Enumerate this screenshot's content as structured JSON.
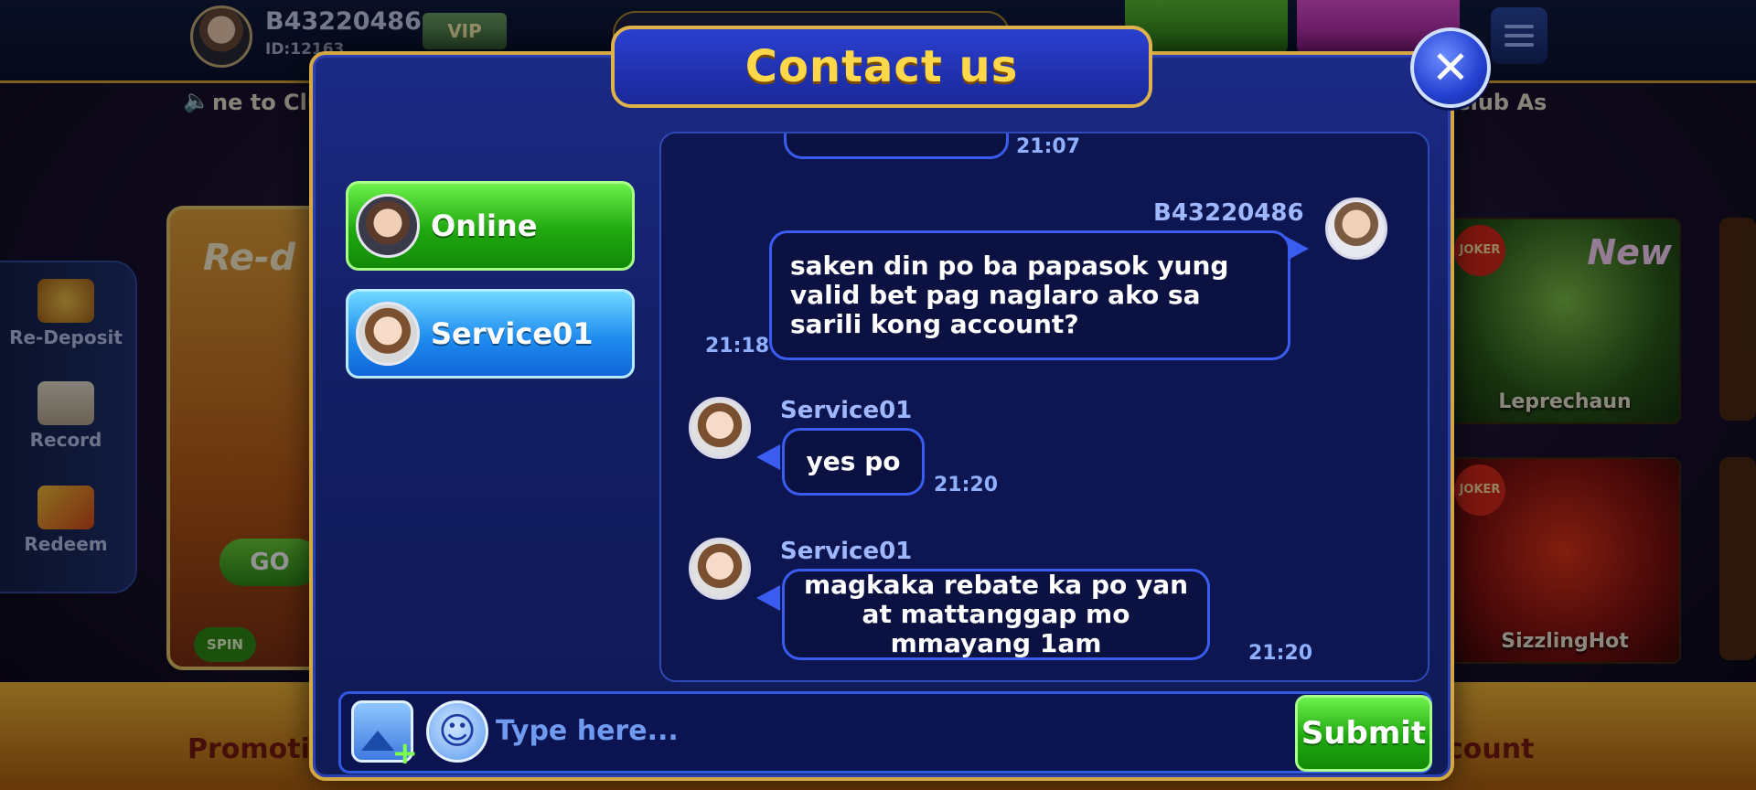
{
  "lobby": {
    "player_name": "B43220486",
    "player_id": "ID:12163",
    "vip_label": "VIP",
    "marquee_left": "ne to Clu",
    "marquee_right": "Club As",
    "rail_items": [
      {
        "label": "Re-Deposit"
      },
      {
        "label": "Record"
      },
      {
        "label": "Redeem"
      }
    ],
    "promo_title": "Re-d",
    "go_label": "GO",
    "spin_label": "SPIN",
    "bottom_left": "Promoti",
    "bottom_right": "count",
    "tiles": [
      {
        "label": "Leprechaun",
        "badge": "JOKER",
        "tag": "New"
      },
      {
        "label": "SizzlingHot",
        "badge": "JOKER"
      }
    ]
  },
  "modal": {
    "title": "Contact us",
    "close_icon": "✕"
  },
  "agents": [
    {
      "label": "Online",
      "icon": "agent-headset-avatar",
      "color": "#20a810"
    },
    {
      "label": "Service01",
      "icon": "agent-avatar",
      "color": "#1f8cf0"
    }
  ],
  "chat": {
    "prev_time": "21:07",
    "messages": [
      {
        "sender": "B43220486",
        "text": "saken din po ba papasok yung valid bet pag naglaro ako sa sarili kong account?",
        "time": "21:18"
      },
      {
        "sender": "Service01",
        "text": "yes po",
        "time": "21:20"
      },
      {
        "sender": "Service01",
        "text": "magkaka rebate ka po yan at mattanggap mo mmayang 1am",
        "time": "21:20"
      }
    ]
  },
  "composer": {
    "placeholder": "Type here...",
    "value": "",
    "submit_label": "Submit",
    "image_icon": "image-upload-icon",
    "emoji_icon": "emoji-icon"
  },
  "colors": {
    "modal_border": "#d2a845",
    "title": "#ffd84a",
    "bubble_border": "#3a5cf0",
    "accent_green": "#20a810",
    "accent_blue": "#1f8cf0"
  }
}
